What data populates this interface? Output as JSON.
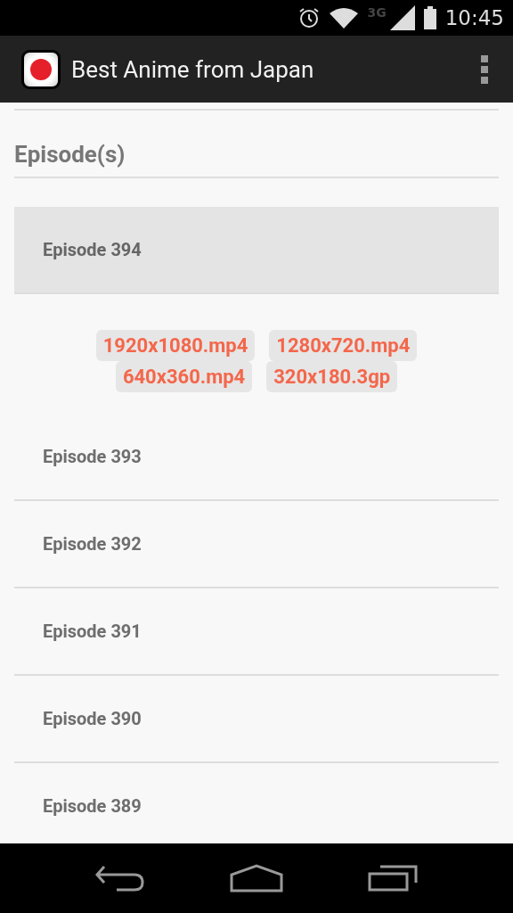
{
  "status_bar": {
    "network": "3G",
    "time": "10:45"
  },
  "app_bar": {
    "title": "Best Anime from Japan"
  },
  "section": {
    "title": "Episode(s)"
  },
  "episodes": [
    {
      "label": "Episode 394",
      "selected": true,
      "formats": [
        "1920x1080.mp4",
        "1280x720.mp4",
        "640x360.mp4",
        "320x180.3gp"
      ]
    },
    {
      "label": "Episode 393",
      "selected": false
    },
    {
      "label": "Episode 392",
      "selected": false
    },
    {
      "label": "Episode 391",
      "selected": false
    },
    {
      "label": "Episode 390",
      "selected": false
    },
    {
      "label": "Episode 389",
      "selected": false
    }
  ]
}
